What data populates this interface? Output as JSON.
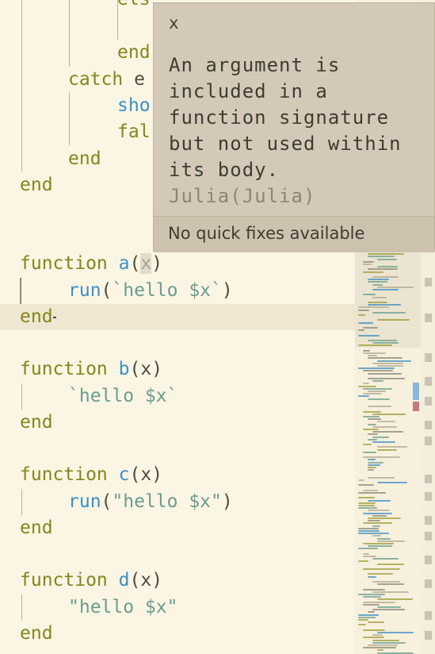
{
  "editor": {
    "lines": {
      "l0_kw": "els",
      "l1_kw": "end",
      "l2_kw": "catch",
      "l2_rest": " e",
      "l3_fn": "sho",
      "l4_kw": "fal",
      "l5_kw": "end",
      "l6_kw": "end",
      "a_kw": "function",
      "a_name": "a",
      "a_open": "(",
      "a_arg": "x",
      "a_close": ")",
      "a_body_fn": "run",
      "a_body_rest": "(",
      "a_body_str": "`hello $x`",
      "a_body_close": ")",
      "a_end": "end",
      "b_kw": "function",
      "b_name": "b",
      "b_sig": "(x)",
      "b_body_str": "`hello $x`",
      "b_end": "end",
      "c_kw": "function",
      "c_name": "c",
      "c_sig": "(x)",
      "c_body_fn": "run",
      "c_body_open": "(",
      "c_body_str": "\"hello $x\"",
      "c_body_close": ")",
      "c_end": "end",
      "d_kw": "function",
      "d_name": "d",
      "d_sig": "(x)",
      "d_body_str": "\"hello $x\"",
      "d_end": "end"
    }
  },
  "hover": {
    "title": "x",
    "message": "An argument is included in a function signature but not used within its body.",
    "source": "Julia(Julia)",
    "footer": "No quick fixes available"
  },
  "colors": {
    "background": "#fbf5e4",
    "keyword": "#86851b",
    "function": "#3c8fc6",
    "string": "#6a9d8f",
    "popup": "#d4c9b7"
  }
}
